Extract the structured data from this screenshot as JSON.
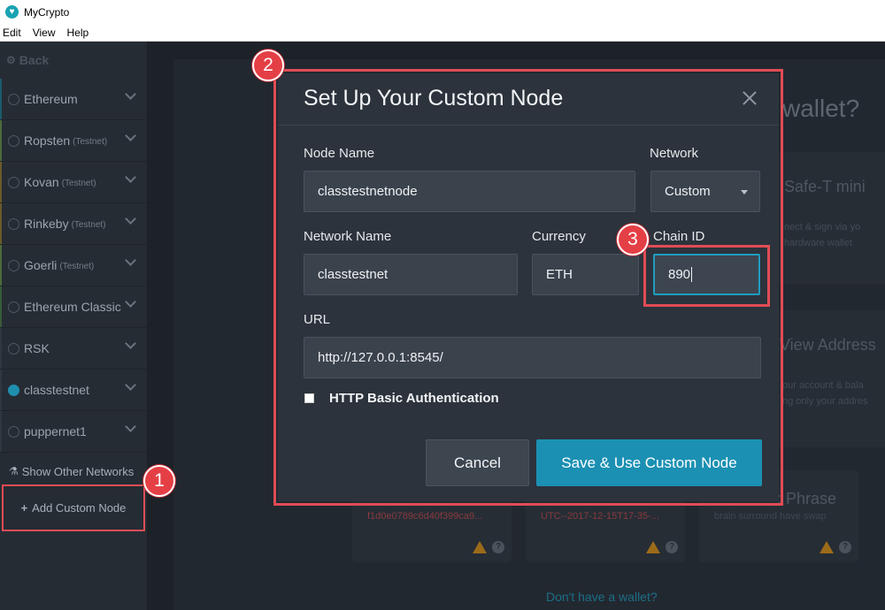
{
  "window": {
    "title": "MyCrypto"
  },
  "menu": [
    "Edit",
    "View",
    "Help"
  ],
  "sidebar": {
    "back_label": "Back",
    "networks": [
      {
        "name": "Ethereum",
        "tag": "",
        "accent": "#1b5c6b"
      },
      {
        "name": "Ropsten",
        "tag": "(Testnet)",
        "accent": "#4d6b3a"
      },
      {
        "name": "Kovan",
        "tag": "(Testnet)",
        "accent": "#6b5b2a"
      },
      {
        "name": "Rinkeby",
        "tag": "(Testnet)",
        "accent": "#6b5b2a"
      },
      {
        "name": "Goerli",
        "tag": "(Testnet)",
        "accent": "#4d6b3a"
      },
      {
        "name": "Ethereum Classic",
        "tag": "",
        "accent": "#3a5b3a"
      },
      {
        "name": "RSK",
        "tag": "",
        "accent": "#2f3740"
      },
      {
        "name": "classtestnet",
        "tag": "",
        "accent": "#2f3740",
        "selected": true
      },
      {
        "name": "puppernet1",
        "tag": "",
        "accent": "#2f3740"
      }
    ],
    "show_other_label": "Show Other Networks",
    "add_custom_label": "Add Custom Node"
  },
  "background": {
    "heading": "wallet?",
    "card1_title": "Safe-T mini",
    "card1_sub_1": "nect & sign via yo",
    "card1_sub_2": "hardware wallet",
    "card2_title": "View Address",
    "card2_sub_1": "our account & bala",
    "card2_sub_2": "ng only your addres",
    "small_cards": [
      {
        "text": "f1d0e0789c6d40f399ca9..."
      },
      {
        "text": "UTC--2017-12-15T17-35-..."
      },
      {
        "title": ": Phrase",
        "text": "brain surround have swap"
      }
    ],
    "footer_link": "Don't have a wallet?"
  },
  "modal": {
    "title": "Set Up Your Custom Node",
    "node_name": {
      "label": "Node Name",
      "value": "classtestnetnode"
    },
    "network": {
      "label": "Network",
      "value": "Custom"
    },
    "network_name": {
      "label": "Network Name",
      "value": "classtestnet"
    },
    "currency": {
      "label": "Currency",
      "value": "ETH"
    },
    "chain_id": {
      "label": "Chain ID",
      "value": "890"
    },
    "url": {
      "label": "URL",
      "value": "http://127.0.0.1:8545/"
    },
    "http_auth_label": "HTTP Basic Authentication",
    "cancel_label": "Cancel",
    "save_label": "Save & Use Custom Node"
  },
  "callouts": [
    "1",
    "2",
    "3"
  ],
  "colors": {
    "accent": "#1b90b3",
    "highlight": "#e14c55",
    "sidebar": "#262c34"
  }
}
